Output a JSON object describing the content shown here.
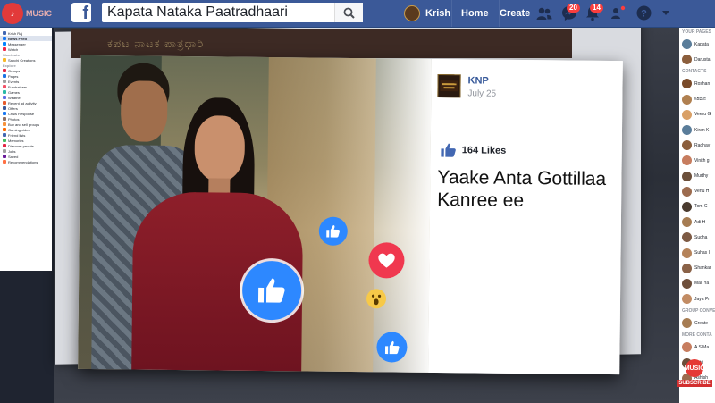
{
  "topbar": {
    "music_logo_text": "MUSIC",
    "search_value": "Kapata Nataka Paatradhaari",
    "profile_name": "Krish",
    "nav_home": "Home",
    "nav_create": "Create",
    "notif_messages": "20",
    "notif_alerts": "14",
    "brand_color": "#3b5998"
  },
  "leftbar": {
    "items": [
      {
        "label": "Krish Raj",
        "type": "item"
      },
      {
        "label": "News Feed",
        "type": "selected"
      },
      {
        "label": "Messenger",
        "type": "item"
      },
      {
        "label": "Watch",
        "type": "item"
      },
      {
        "label": "Shortcuts",
        "type": "section"
      },
      {
        "label": "Sanchi Creations",
        "type": "item"
      },
      {
        "label": "Explore",
        "type": "section"
      },
      {
        "label": "Groups",
        "type": "item"
      },
      {
        "label": "Pages",
        "type": "item"
      },
      {
        "label": "Events",
        "type": "item"
      },
      {
        "label": "Fundraisers",
        "type": "item"
      },
      {
        "label": "Games",
        "type": "item"
      },
      {
        "label": "Weather",
        "type": "item"
      },
      {
        "label": "Recent ad activity",
        "type": "item"
      },
      {
        "label": "Offers",
        "type": "item"
      },
      {
        "label": "Crisis Response",
        "type": "item"
      },
      {
        "label": "Photos",
        "type": "item"
      },
      {
        "label": "Buy and sell groups",
        "type": "item"
      },
      {
        "label": "Gaming video",
        "type": "item"
      },
      {
        "label": "Friend lists",
        "type": "item"
      },
      {
        "label": "Memories",
        "type": "item"
      },
      {
        "label": "Discover people",
        "type": "item"
      },
      {
        "label": "Jobs",
        "type": "item"
      },
      {
        "label": "Saved",
        "type": "item"
      },
      {
        "label": "Recommendations",
        "type": "item"
      }
    ]
  },
  "rightbar": {
    "your_pages_label": "YOUR PAGES",
    "pages": [
      "Kapata",
      "Darusta"
    ],
    "contacts_label": "CONTACTS",
    "contacts": [
      "Roshan",
      "ಸಿರಿಮನ",
      "Veeru G",
      "Kiran K",
      "Raghav",
      "Vinith g",
      "Murthy",
      "Venu H",
      "Tom C",
      "Adi H",
      "Sudha",
      "Suhas I",
      "Shankar",
      "Mali Ya",
      "Jaya Pr"
    ],
    "group_conv_label": "GROUP CONVE",
    "create_label": "Create",
    "more_contacts_label": "MORE CONTA",
    "more_contacts": [
      "A S Ma",
      "Kotri",
      "Ashish"
    ]
  },
  "subscribe": {
    "label": "SUBSCRIBE",
    "bell_text": "MUSIC"
  },
  "background": {
    "banner_text": "ಕಪಟ ನಾಟಕ ಪಾತ್ರಧಾರಿ"
  },
  "post": {
    "page_name": "KNP",
    "date": "July 25",
    "likes": "164 Likes",
    "caption": "Yaake Anta Gottillaa Kanree ee"
  }
}
